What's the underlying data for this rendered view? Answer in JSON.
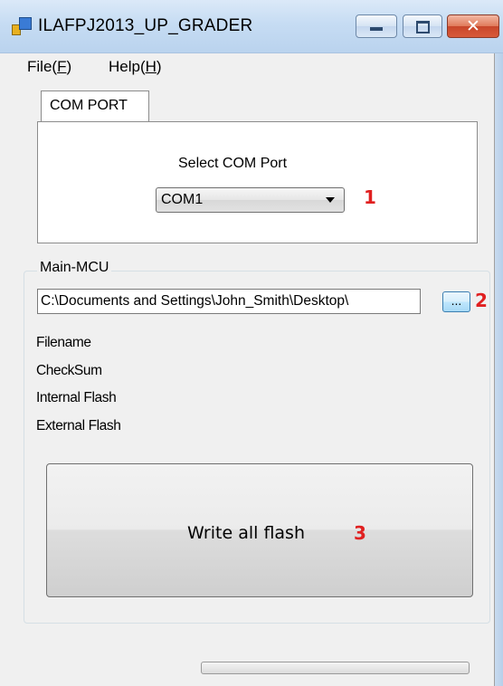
{
  "window": {
    "title": "ILAFPJ2013_UP_GRADER",
    "close_glyph": "✕"
  },
  "menu": {
    "items": [
      {
        "label": "File",
        "mnemonic": "F"
      },
      {
        "label": "Help",
        "mnemonic": "H"
      }
    ]
  },
  "com_port_tab": {
    "tab_label": "COM PORT",
    "select_label": "Select COM Port",
    "selected_port": "COM1",
    "marker": "1"
  },
  "main_mcu": {
    "group_title": "Main-MCU",
    "file_path": "C:\\Documents and Settings\\John_Smith\\Desktop\\",
    "browse_label": "...",
    "browse_marker": "2",
    "info_labels": [
      "Filename",
      "CheckSum",
      "Internal Flash",
      "External Flash"
    ],
    "write_button_label": "Write all flash",
    "write_marker": "3"
  },
  "progress": {
    "value": 0
  },
  "colors": {
    "marker": "#e02020",
    "client_background": "#f0f0f0",
    "progress_fill": "#06b025"
  },
  "icons": {
    "app": "app-icon",
    "minimize": "minimize-icon",
    "maximize": "maximize-icon",
    "close": "close-icon",
    "dropdown": "chevron-down-icon"
  }
}
